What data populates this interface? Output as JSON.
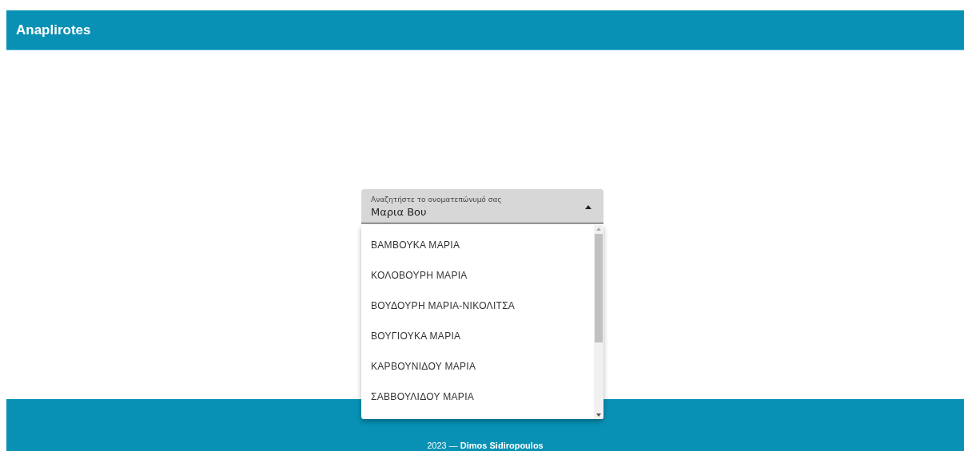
{
  "header": {
    "title": "Anaplirotes"
  },
  "search": {
    "label": "Αναζητήστε το ονοματεπώνυμό σας",
    "value": "Μαρια Βου",
    "expanded": true
  },
  "options": [
    {
      "label": "ΒΑΜΒΟΥΚΑ ΜΑΡΙΑ"
    },
    {
      "label": "ΚΟΛΟΒΟΥΡΗ ΜΑΡΙΑ"
    },
    {
      "label": "ΒΟΥΔΟΥΡΗ ΜΑΡΙΑ-ΝΙΚΟΛΙΤΣΑ"
    },
    {
      "label": "ΒΟΥΓΙΟΥΚΑ ΜΑΡΙΑ"
    },
    {
      "label": "ΚΑΡΒΟΥΝΙΔΟΥ ΜΑΡΙΑ"
    },
    {
      "label": "ΣΑΒΒΟΥΛΙΔΟΥ ΜΑΡΙΑ"
    }
  ],
  "footer": {
    "text": "2023 — **Dimos Sidiropoulos**"
  }
}
